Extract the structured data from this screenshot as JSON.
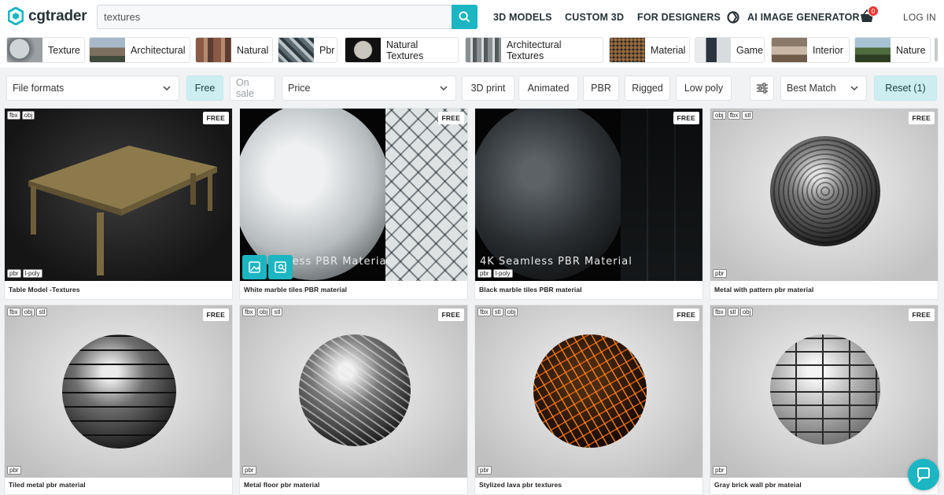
{
  "header": {
    "logo_text": "cgtrader",
    "search_value": "textures",
    "nav": [
      "3D MODELS",
      "CUSTOM 3D",
      "FOR DESIGNERS",
      "AI IMAGE GENERATOR"
    ],
    "cart_count": "0",
    "login": "LOG IN"
  },
  "categories": [
    "Texture",
    "Architectural",
    "Natural",
    "Pbr",
    "Natural Textures",
    "Architectural Textures",
    "Material",
    "Game",
    "Interior",
    "Nature"
  ],
  "filters": {
    "file_formats": "File formats",
    "free": "Free",
    "on_sale": "On sale",
    "price": "Price",
    "print3d": "3D print",
    "animated": "Animated",
    "pbr": "PBR",
    "rigged": "Rigged",
    "low_poly": "Low poly",
    "sort": "Best Match",
    "reset": "Reset (1)"
  },
  "products": [
    {
      "title": "Table Model -Textures",
      "formats": [
        "fbx",
        "obj"
      ],
      "tags": [
        "pbr",
        "l-poly"
      ],
      "badge": "FREE"
    },
    {
      "title": "White marble tiles PBR material",
      "formats": [],
      "tags": [],
      "badge": "FREE",
      "overlay": "less PBR Material"
    },
    {
      "title": "Black marble tiles PBR material",
      "formats": [],
      "tags": [
        "pbr",
        "l-poly"
      ],
      "badge": "FREE",
      "overlay": "4K Seamless PBR Material"
    },
    {
      "title": "Metal with pattern pbr material",
      "formats": [
        "obj",
        "fbx",
        "stl"
      ],
      "tags": [
        "pbr"
      ],
      "badge": "FREE"
    },
    {
      "title": "Tiled metal pbr material",
      "formats": [
        "fbx",
        "obj",
        "stl"
      ],
      "tags": [
        "pbr"
      ],
      "badge": "FREE"
    },
    {
      "title": "Metal floor pbr material",
      "formats": [
        "fbx",
        "obj",
        "stl"
      ],
      "tags": [
        "pbr"
      ],
      "badge": "FREE"
    },
    {
      "title": "Stylized lava pbr textures",
      "formats": [
        "fbx",
        "stl",
        "obj"
      ],
      "tags": [
        "pbr"
      ],
      "badge": "FREE"
    },
    {
      "title": "Gray brick wall pbr mateial",
      "formats": [
        "fbx",
        "stl",
        "obj"
      ],
      "tags": [
        "pbr"
      ],
      "badge": "FREE"
    }
  ],
  "colors": {
    "accent": "#1bb6c2",
    "selected_filter": "#cdeef1",
    "cart_badge": "#e53935"
  }
}
